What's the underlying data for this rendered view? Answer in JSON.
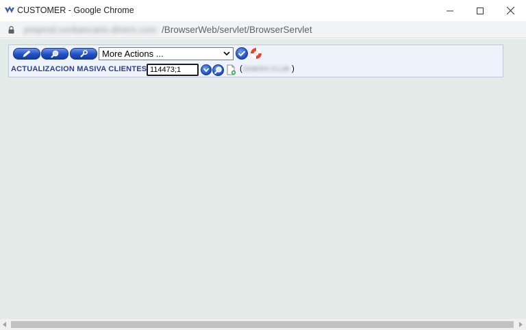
{
  "window": {
    "title": "CUSTOMER - Google Chrome"
  },
  "address_bar": {
    "host": "preprod.conbancario.diners.com",
    "path": "/BrowserWeb/servlet/BrowserServlet"
  },
  "toolbar": {
    "actions_select_value": "More Actions ..."
  },
  "form": {
    "section_label": "ACTUALIZACION MASIVA CLIENTES",
    "client_id_value": "114473;1",
    "paren_open": "(",
    "client_name": "DINERS CLUB",
    "paren_close": ")"
  },
  "colors": {
    "page_background": "#e2ebe7",
    "panel_background": "#eef3fb",
    "button_blue": "#2150c8",
    "label_navy": "#2b3f8c"
  },
  "icons": {
    "edit": "pencil-icon",
    "search": "magnifier-icon",
    "tools": "wrench-icon",
    "confirm": "check-icon",
    "help": "lifebuoy-icon",
    "new_record": "new-document-icon"
  }
}
